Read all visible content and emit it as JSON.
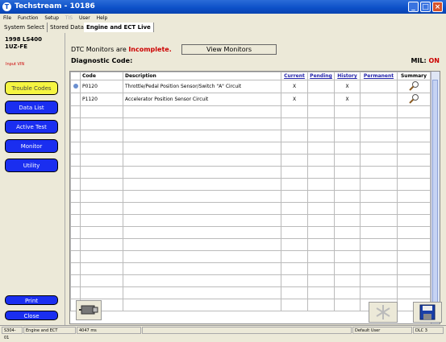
{
  "window": {
    "title": "Techstream - 10186",
    "app_icon_label": "T"
  },
  "menu": [
    "File",
    "Function",
    "Setup",
    "TIS",
    "User",
    "Help"
  ],
  "tabs": [
    {
      "label": "System Select"
    },
    {
      "label": "Stored Data"
    },
    {
      "label": "Engine and ECT Live"
    }
  ],
  "vehicle": {
    "model": "1998 LS400",
    "engine": "1UZ-FE",
    "input_vin": "Input VIN"
  },
  "nav": [
    {
      "label": "Trouble Codes",
      "selected": true
    },
    {
      "label": "Data List"
    },
    {
      "label": "Active Test"
    },
    {
      "label": "Monitor"
    },
    {
      "label": "Utility"
    }
  ],
  "bottom_nav": {
    "print": "Print",
    "close": "Close"
  },
  "header": {
    "monitors_prefix": "DTC Monitors are",
    "monitors_status": "Incomplete.",
    "view_monitors": "View Monitors",
    "diag_code_label": "Diagnostic Code:",
    "mil_label": "MIL:",
    "mil_value": "ON"
  },
  "table": {
    "columns": [
      "Code",
      "Description",
      "Current",
      "Pending",
      "History",
      "Permanent",
      "Summary"
    ],
    "rows": [
      {
        "code": "P0120",
        "description": "Throttle/Pedal Position Sensor/Switch \"A\" Circuit",
        "current": "X",
        "pending": "",
        "history": "X",
        "permanent": ""
      },
      {
        "code": "P1120",
        "description": "Accelerator Position Sensor Circuit",
        "current": "X",
        "pending": "",
        "history": "X",
        "permanent": ""
      }
    ]
  },
  "status": {
    "code": "S304-01",
    "system": "Engine and ECT",
    "timing": "4047 ms",
    "user": "Default User",
    "dlc": "DLC 3"
  },
  "colors": {
    "title_blue": "#0c4fc7",
    "nav_blue": "#1a2ef0",
    "nav_selected": "#f5f542",
    "alert_red": "#cc0000"
  }
}
